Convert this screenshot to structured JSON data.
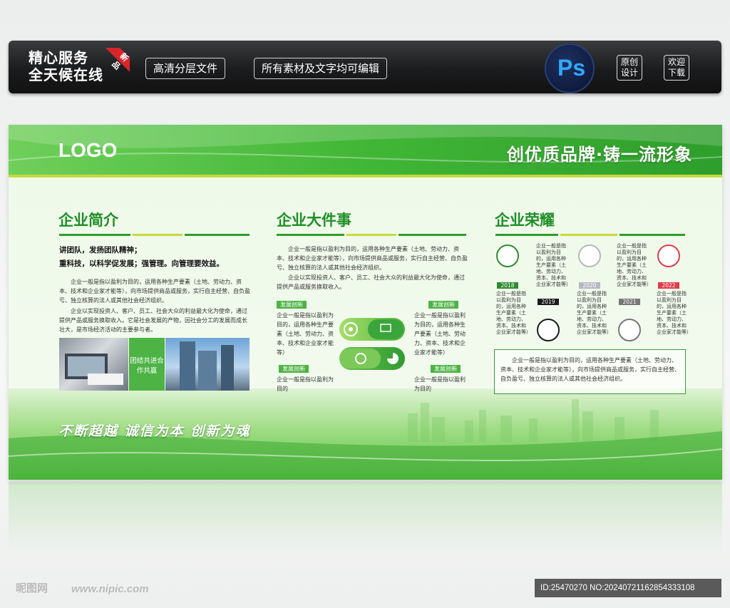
{
  "banner": {
    "brand_line1": "精心服务",
    "brand_line2": "全天候在线",
    "new_badge": "新品",
    "pill1": "高清分层文件",
    "pill2": "所有素材及文字均可编辑",
    "ps_logo": "Ps",
    "original": "原创设计",
    "download": "欢迎下载"
  },
  "board": {
    "logo": "LOGO",
    "slogan": "创优质品牌·铸一流形象",
    "intro": {
      "title": "企业简介",
      "line1": "讲团队，发扬团队精神；",
      "line2": "重科技，以科学促发展；强管理。向管理要效益。",
      "p1": "企业一般是指以盈利为目的，运用各种生产要素（土地、劳动力、资本、技术和企业家才能等），向市场提供商品或服务，实行自主经营、自负盈亏、独立核算的法人或其他社会经济组织。",
      "p2": "企业以实现投资人、客户、员工、社会大众的利益最大化为使命，通过提供产品或服务换取收入。它是社会发展的产物，因社会分工的发展而成长壮大，是市场经济活动的主要参与者。",
      "green_box": "团结共进合作共赢"
    },
    "events": {
      "title": "企业大件事",
      "p1": "企业一般是指以盈利为目的，运用各种生产要素（土地、劳动力、资本、技术和企业家才能等），向市场提供商品或服务，实行自主经营、自负盈亏、独立核算的法人或其他社会经济组织。",
      "p2": "企业以实现投资人、客户、员工、社会大众的利益最大化为使命，通过提供产品或服务换取收入。",
      "tag": "发展创新",
      "block_long": "企业一般是指以盈利为目的，运用各种生产要素（土地、劳动力、资本、技术和企业家才能等）",
      "block_short": "企业一般是指以盈利为目的"
    },
    "honors": {
      "title": "企业荣耀",
      "years": [
        "2018",
        "2019",
        "2020",
        "2021",
        "2022"
      ],
      "item_text": "企业一般是指以盈利为目的，运用各种生产要素（土地、劳动力、资本、技术和企业家才能等）",
      "summary": "企业一般是指以盈利为目的，运用各种生产要素（土地、劳动力、资本、技术和企业家才能等），向市场提供商品或服务，实行自主经营、自负盈亏、独立核算的法人或其他社会经济组织。"
    },
    "motto": "不断超越  诚信为本  创新为魂"
  },
  "footer": {
    "watermark_cn": "昵图网",
    "watermark_url": "www.nipic.com",
    "id_text": "ID:25470270 NO:20240721162854333108"
  },
  "colors": {
    "primary_green": "#41b636",
    "dark_green": "#1e8e27",
    "accent_yellow": "#c8d93b",
    "year_2018": "#2e8b2e",
    "year_2019": "#1a1a1a",
    "year_2020": "#b7b7c2",
    "year_2021": "#777777",
    "year_2022": "#e23b4a"
  }
}
